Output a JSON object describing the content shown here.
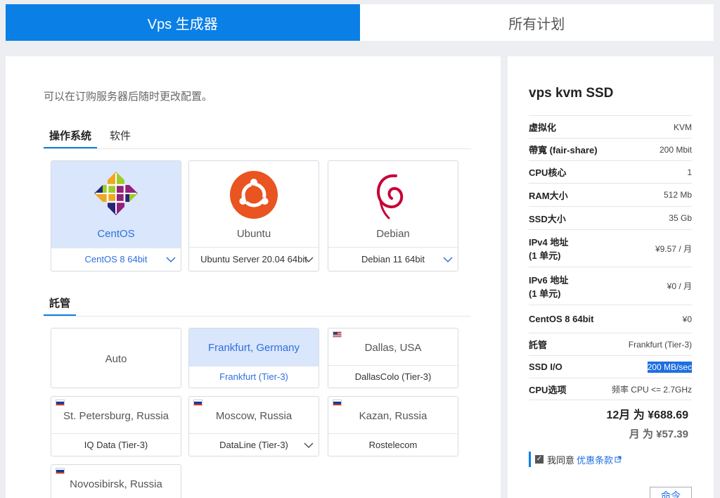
{
  "tabs": {
    "builder": "Vps 生成器",
    "all_plans": "所有计划"
  },
  "intro": "可以在订购服务器后随时更改配置。",
  "os_tabs": {
    "os": "操作系统",
    "software": "软件"
  },
  "os_cards": [
    {
      "name": "CentOS",
      "version": "CentOS 8 64bit"
    },
    {
      "name": "Ubuntu",
      "version": "Ubuntu Server 20.04 64bit"
    },
    {
      "name": "Debian",
      "version": "Debian 11 64bit"
    }
  ],
  "hosting_title": "託管",
  "locations": [
    {
      "name": "Auto"
    },
    {
      "name": "Frankfurt, Germany",
      "dc": "Frankfurt (Tier-3)",
      "flag": "de"
    },
    {
      "name": "Dallas, USA",
      "dc": "DallasColo (Tier-3)",
      "flag": "us"
    },
    {
      "name": "St. Petersburg, Russia",
      "dc": "IQ Data (Tier-3)",
      "flag": "ru"
    },
    {
      "name": "Moscow, Russia",
      "dc": "DataLine (Tier-3)",
      "flag": "ru"
    },
    {
      "name": "Kazan, Russia",
      "dc": "Rostelecom",
      "flag": "ru"
    },
    {
      "name": "Novosibirsk, Russia",
      "flag": "ru"
    }
  ],
  "summary": {
    "title": "vps kvm SSD",
    "specs": [
      {
        "k": "虚拟化",
        "v": "KVM"
      },
      {
        "k": "帶寬 (fair-share)",
        "v": "200 Mbit"
      },
      {
        "k": "CPU核心",
        "v": "1"
      },
      {
        "k": "RAM大小",
        "v": "512 Mb"
      },
      {
        "k": "SSD大小",
        "v": "35 Gb"
      },
      {
        "k": "IPv4 地址",
        "k2": "(1 单元)",
        "v": "¥9.57 / 月"
      },
      {
        "k": "IPv6 地址",
        "k2": "(1 单元)",
        "v": "¥0 / 月"
      },
      {
        "k": "CentOS 8 64bit",
        "v": "¥0"
      },
      {
        "k": "託管",
        "v": "Frankfurt (Tier-3)"
      },
      {
        "k": "SSD I/O",
        "v": "200 MB/sec"
      },
      {
        "k": "CPU选项",
        "v": "频率 CPU <= 2.7GHz"
      }
    ],
    "total_year": "12月 为 ¥688.69",
    "total_month": "月 为 ¥57.39",
    "agree_text": "我同意",
    "agree_link": "优惠条款",
    "order_button": "命令"
  },
  "colors": {
    "accent": "#0a7fe6",
    "selected_bg": "#d9e6fb",
    "ubuntu": "#e95420",
    "debian": "#c70036"
  }
}
